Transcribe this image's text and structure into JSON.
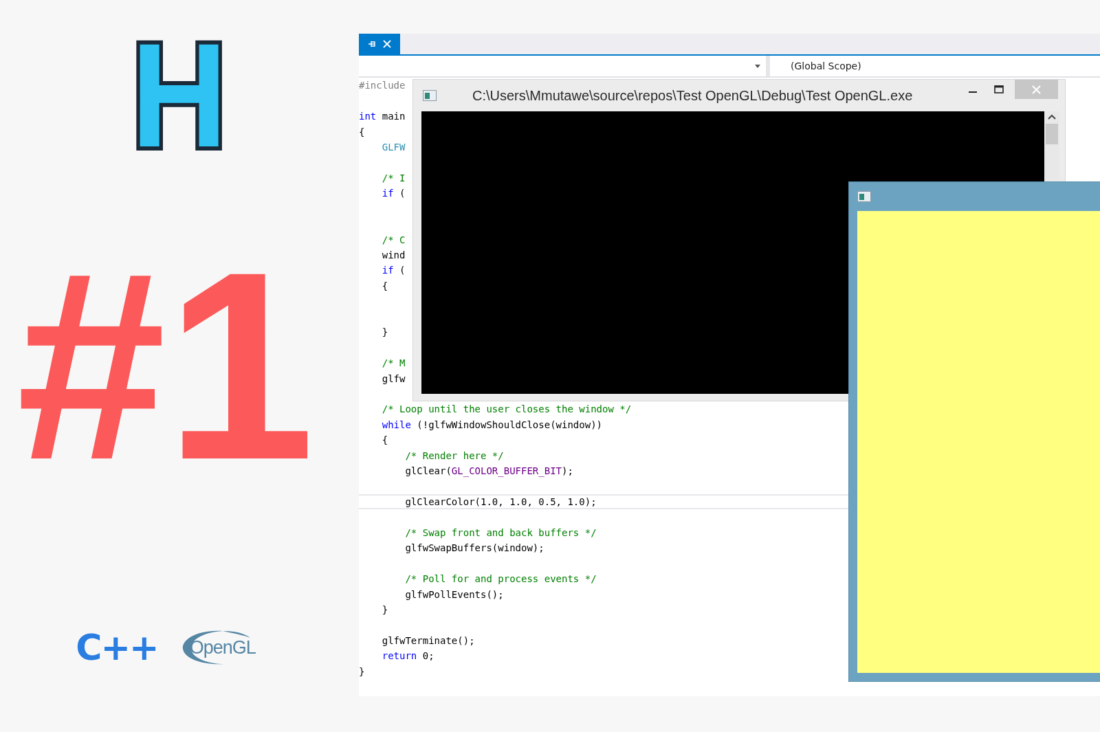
{
  "brand": {
    "logo_letter": "H",
    "episode": "#1",
    "language": "C++",
    "library": "OpenGL"
  },
  "navigation": {
    "scope": "(Global Scope)"
  },
  "code_lines": [
    {
      "kind": "code",
      "tokens": [
        {
          "kind": "preproc",
          "text": "#include"
        }
      ]
    },
    {
      "kind": "blank"
    },
    {
      "kind": "code",
      "tokens": [
        {
          "kind": "keyword",
          "text": "int"
        },
        {
          "kind": "plain",
          "text": " main"
        }
      ]
    },
    {
      "kind": "code",
      "tokens": [
        {
          "kind": "plain",
          "text": "{"
        }
      ]
    },
    {
      "kind": "code",
      "tokens": [
        {
          "kind": "type",
          "text": "    GLFW"
        }
      ]
    },
    {
      "kind": "blank"
    },
    {
      "kind": "code",
      "tokens": [
        {
          "kind": "comment",
          "text": "    /* I"
        }
      ]
    },
    {
      "kind": "code",
      "tokens": [
        {
          "kind": "keyword",
          "text": "    if"
        },
        {
          "kind": "plain",
          "text": " ("
        }
      ]
    },
    {
      "kind": "blank"
    },
    {
      "kind": "blank"
    },
    {
      "kind": "code",
      "tokens": [
        {
          "kind": "comment",
          "text": "    /* C"
        }
      ]
    },
    {
      "kind": "code",
      "tokens": [
        {
          "kind": "plain",
          "text": "    wind"
        }
      ]
    },
    {
      "kind": "code",
      "tokens": [
        {
          "kind": "keyword",
          "text": "    if"
        },
        {
          "kind": "plain",
          "text": " ("
        }
      ]
    },
    {
      "kind": "code",
      "tokens": [
        {
          "kind": "plain",
          "text": "    {"
        }
      ]
    },
    {
      "kind": "blank"
    },
    {
      "kind": "blank"
    },
    {
      "kind": "code",
      "tokens": [
        {
          "kind": "plain",
          "text": "    }"
        }
      ]
    },
    {
      "kind": "blank"
    },
    {
      "kind": "code",
      "tokens": [
        {
          "kind": "comment",
          "text": "    /* M"
        }
      ]
    },
    {
      "kind": "code",
      "tokens": [
        {
          "kind": "plain",
          "text": "    glfw"
        }
      ]
    },
    {
      "kind": "blank"
    },
    {
      "kind": "code",
      "tokens": [
        {
          "kind": "comment",
          "text": "    /* Loop until the user closes the window */"
        }
      ]
    },
    {
      "kind": "code",
      "tokens": [
        {
          "kind": "keyword",
          "text": "    while"
        },
        {
          "kind": "plain",
          "text": " (!glfwWindowShouldClose(window))"
        }
      ]
    },
    {
      "kind": "code",
      "tokens": [
        {
          "kind": "plain",
          "text": "    {"
        }
      ]
    },
    {
      "kind": "code",
      "tokens": [
        {
          "kind": "comment",
          "text": "        /* Render here */"
        }
      ]
    },
    {
      "kind": "code",
      "tokens": [
        {
          "kind": "plain",
          "text": "        glClear("
        },
        {
          "kind": "macro",
          "text": "GL_COLOR_BUFFER_BIT"
        },
        {
          "kind": "plain",
          "text": ");"
        }
      ]
    },
    {
      "kind": "blank"
    },
    {
      "kind": "code",
      "current": true,
      "tokens": [
        {
          "kind": "plain",
          "text": "        glClearColor(1.0, 1.0, 0.5, 1.0);"
        }
      ]
    },
    {
      "kind": "blank"
    },
    {
      "kind": "code",
      "tokens": [
        {
          "kind": "comment",
          "text": "        /* Swap front and back buffers */"
        }
      ]
    },
    {
      "kind": "code",
      "tokens": [
        {
          "kind": "plain",
          "text": "        glfwSwapBuffers(window);"
        }
      ]
    },
    {
      "kind": "blank"
    },
    {
      "kind": "code",
      "tokens": [
        {
          "kind": "comment",
          "text": "        /* Poll for and process events */"
        }
      ]
    },
    {
      "kind": "code",
      "tokens": [
        {
          "kind": "plain",
          "text": "        glfwPollEvents();"
        }
      ]
    },
    {
      "kind": "code",
      "tokens": [
        {
          "kind": "plain",
          "text": "    }"
        }
      ]
    },
    {
      "kind": "blank"
    },
    {
      "kind": "code",
      "tokens": [
        {
          "kind": "plain",
          "text": "    glfwTerminate();"
        }
      ]
    },
    {
      "kind": "code",
      "tokens": [
        {
          "kind": "keyword",
          "text": "    return"
        },
        {
          "kind": "plain",
          "text": " 0;"
        }
      ]
    },
    {
      "kind": "code",
      "tokens": [
        {
          "kind": "plain",
          "text": "}"
        }
      ]
    }
  ],
  "console_window": {
    "title": "C:\\Users\\Mmutawe\\source\\repos\\Test OpenGL\\Debug\\Test OpenGL.exe"
  }
}
